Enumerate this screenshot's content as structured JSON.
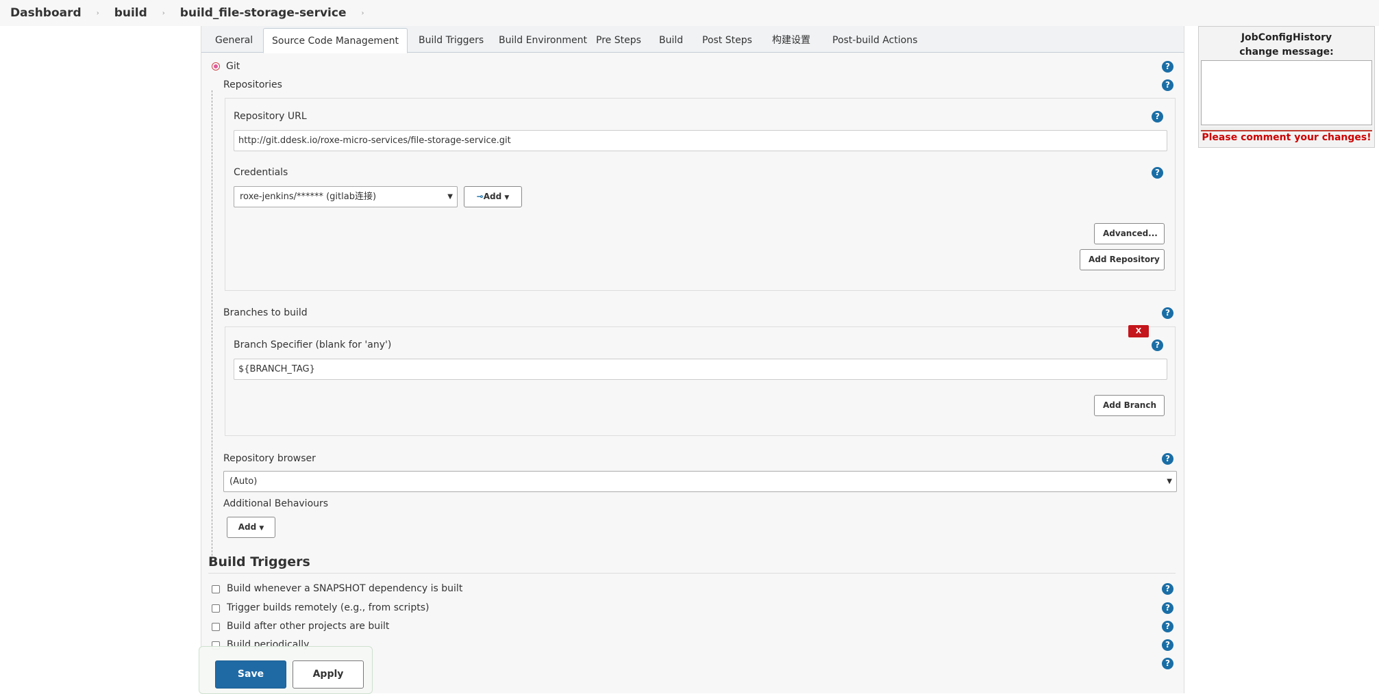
{
  "breadcrumb": {
    "items": [
      "Dashboard",
      "build",
      "build_file-storage-service"
    ],
    "separator": "›"
  },
  "tabs": [
    {
      "label": "General"
    },
    {
      "label": "Source Code Management"
    },
    {
      "label": "Build Triggers"
    },
    {
      "label": "Build Environment"
    },
    {
      "label": "Pre Steps"
    },
    {
      "label": "Build"
    },
    {
      "label": "Post Steps"
    },
    {
      "label": "构建设置"
    },
    {
      "label": "Post-build Actions"
    }
  ],
  "active_tab": "Source Code Management",
  "scm": {
    "git_label": "Git",
    "repositories_label": "Repositories",
    "repo_url_label": "Repository URL",
    "repo_url_value": "http://git.ddesk.io/roxe-micro-services/file-storage-service.git",
    "credentials_label": "Credentials",
    "credentials_value": "roxe-jenkins/****** (gitlab连接)",
    "add_label": "Add",
    "advanced_label": "Advanced...",
    "add_repository_label": "Add Repository",
    "branches_label": "Branches to build",
    "delete_label": "X",
    "branch_specifier_label": "Branch Specifier (blank for 'any')",
    "branch_specifier_value": "${BRANCH_TAG}",
    "add_branch_label": "Add Branch",
    "repo_browser_label": "Repository browser",
    "repo_browser_value": "(Auto)",
    "additional_behaviours_label": "Additional Behaviours",
    "additional_add_label": "Add"
  },
  "build_triggers": {
    "title": "Build Triggers",
    "options": [
      {
        "label": "Build whenever a SNAPSHOT dependency is built",
        "checked": false
      },
      {
        "label": "Trigger builds remotely (e.g., from scripts)",
        "checked": false
      },
      {
        "label": "Build after other projects are built",
        "checked": false
      },
      {
        "label": "Build periodically",
        "checked": false
      }
    ]
  },
  "actions": {
    "save_label": "Save",
    "apply_label": "Apply"
  },
  "job_config_history": {
    "title_line1": "JobConfigHistory",
    "title_line2": "change message:",
    "warning": "Please comment your changes!"
  },
  "help_icon": "?",
  "colors": {
    "help": "#1a6ea6",
    "save": "#1f6aa5",
    "warning": "#cc0000",
    "delete": "#c4161c"
  }
}
